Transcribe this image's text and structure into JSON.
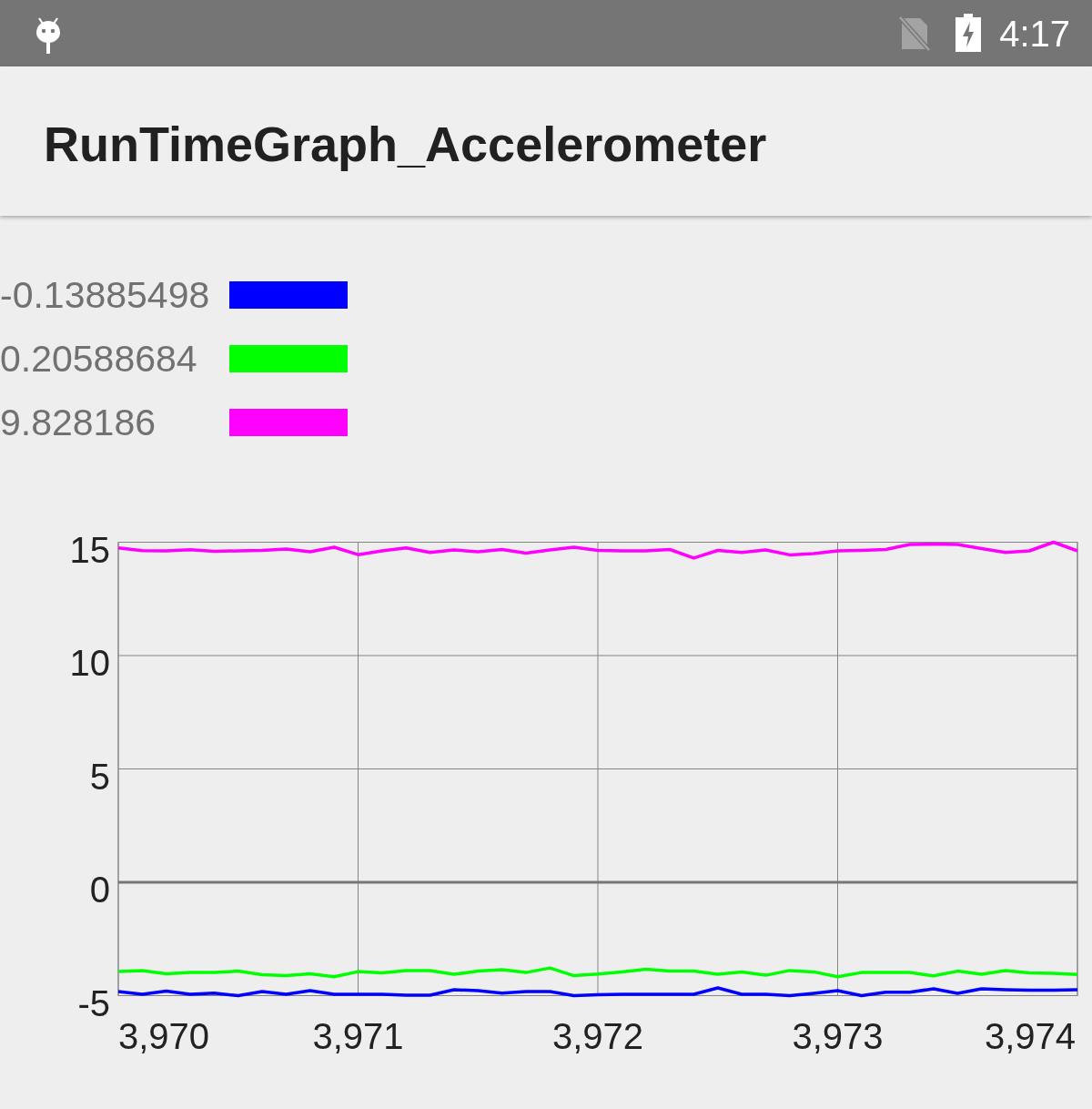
{
  "status_bar": {
    "time": "4:17"
  },
  "app_bar": {
    "title": "RunTimeGraph_Accelerometer"
  },
  "legend": [
    {
      "value": "-0.13885498",
      "color": "#0000ff"
    },
    {
      "value": "0.20588684",
      "color": "#00ff00"
    },
    {
      "value": "9.828186",
      "color": "#ff00ff"
    }
  ],
  "chart": {
    "chart_data": {
      "type": "line",
      "grid": true,
      "x": [
        3970,
        3970.1,
        3970.2,
        3970.3,
        3970.4,
        3970.5,
        3970.6,
        3970.7,
        3970.8,
        3970.9,
        3971,
        3971.1,
        3971.2,
        3971.3,
        3971.4,
        3971.5,
        3971.6,
        3971.7,
        3971.8,
        3971.9,
        3972,
        3972.1,
        3972.2,
        3972.3,
        3972.4,
        3972.5,
        3972.6,
        3972.7,
        3972.8,
        3972.9,
        3973,
        3973.1,
        3973.2,
        3973.3,
        3973.4,
        3973.5,
        3973.6,
        3973.7,
        3973.8,
        3973.9,
        3974
      ],
      "series": [
        {
          "color": "#0000ff",
          "values": [
            -4.82,
            -4.94,
            -4.8,
            -4.94,
            -4.89,
            -5.0,
            -4.82,
            -4.94,
            -4.78,
            -4.94,
            -4.94,
            -4.94,
            -4.98,
            -4.98,
            -4.74,
            -4.78,
            -4.89,
            -4.82,
            -4.82,
            -5.0,
            -4.96,
            -4.94,
            -4.94,
            -4.94,
            -4.94,
            -4.66,
            -4.94,
            -4.94,
            -5.0,
            -4.9,
            -4.78,
            -5.0,
            -4.85,
            -4.85,
            -4.7,
            -4.9,
            -4.7,
            -4.74,
            -4.76,
            -4.76,
            -4.74
          ]
        },
        {
          "color": "#00ff00",
          "values": [
            -3.94,
            -3.9,
            -4.04,
            -3.98,
            -3.98,
            -3.92,
            -4.08,
            -4.12,
            -4.04,
            -4.17,
            -3.94,
            -3.99,
            -3.9,
            -3.9,
            -4.06,
            -3.92,
            -3.85,
            -3.98,
            -3.78,
            -4.12,
            -4.05,
            -3.95,
            -3.84,
            -3.92,
            -3.92,
            -4.06,
            -3.96,
            -4.1,
            -3.89,
            -3.95,
            -4.17,
            -3.98,
            -3.98,
            -3.98,
            -4.13,
            -3.92,
            -4.06,
            -3.89,
            -4.0,
            -4.02,
            -4.07
          ]
        },
        {
          "color": "#ff00ff",
          "values": [
            14.75,
            14.63,
            14.62,
            14.67,
            14.6,
            14.62,
            14.64,
            14.7,
            14.58,
            14.78,
            14.45,
            14.62,
            14.75,
            14.55,
            14.66,
            14.58,
            14.68,
            14.52,
            14.66,
            14.78,
            14.64,
            14.62,
            14.62,
            14.68,
            14.3,
            14.64,
            14.55,
            14.66,
            14.44,
            14.5,
            14.62,
            14.64,
            14.68,
            14.9,
            14.92,
            14.9,
            14.72,
            14.55,
            14.62,
            15.0,
            14.62
          ]
        }
      ],
      "xlim": [
        3970,
        3974
      ],
      "ylim": [
        -5,
        15
      ],
      "xticks": [
        {
          "value": 3970,
          "label": "3,970"
        },
        {
          "value": 3971,
          "label": "3,971"
        },
        {
          "value": 3972,
          "label": "3,972"
        },
        {
          "value": 3973,
          "label": "3,973"
        },
        {
          "value": 3974,
          "label": "3,974"
        }
      ],
      "yticks": [
        -5,
        0,
        5,
        10,
        15
      ]
    }
  }
}
